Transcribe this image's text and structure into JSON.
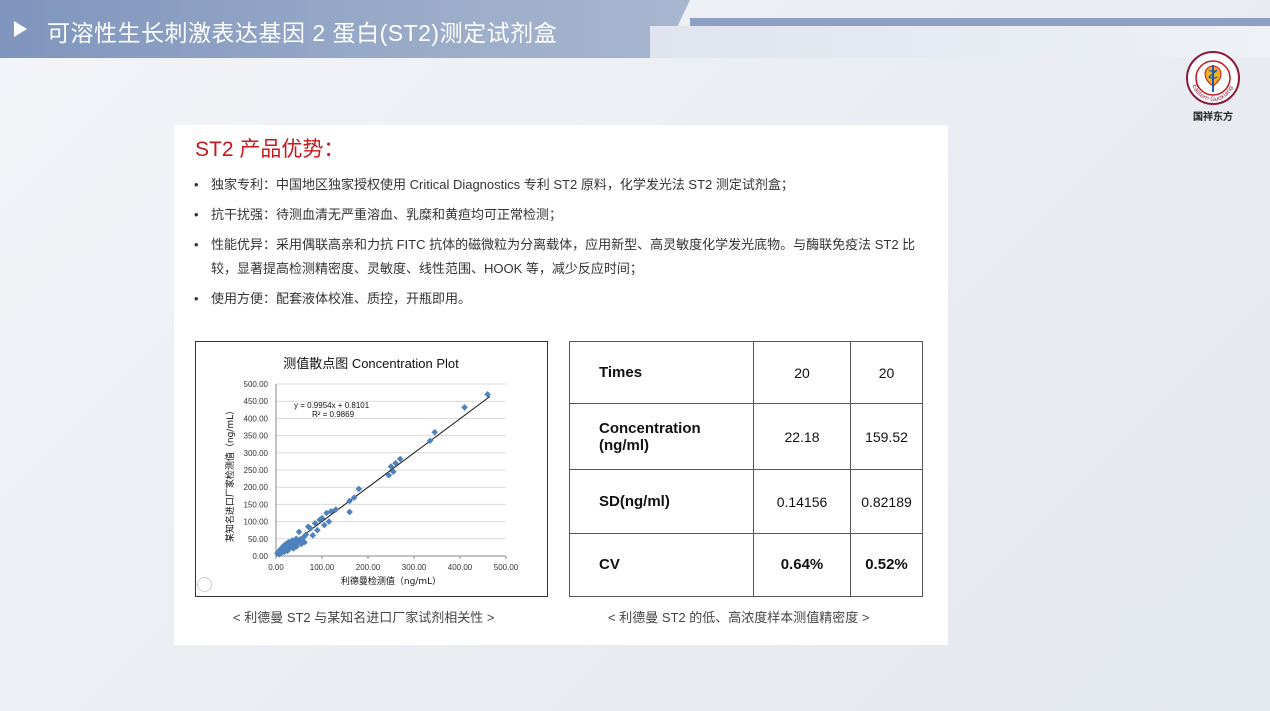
{
  "header": {
    "title": "可溶性生长刺激表达基因 2 蛋白(ST2)测定试剂盒"
  },
  "logo": {
    "ring_text": "Eastern Guoxiang",
    "name": "国祥东方"
  },
  "section": {
    "title": "ST2 产品优势：",
    "bullet_symbol": "•",
    "bullets": [
      "独家专利：中国地区独家授权使用 Critical Diagnostics 专利 ST2 原料，化学发光法 ST2 测定试剂盒；",
      "抗干扰强：待测血清无严重溶血、乳糜和黄疸均可正常检测；",
      "性能优异：采用偶联高亲和力抗 FITC 抗体的磁微粒为分离载体，应用新型、高灵敏度化学发光底物。与酶联免疫法 ST2 比较，显著提高检测精密度、灵敏度、线性范围、HOOK 等，减少反应时间；",
      "使用方便：配套液体校准、质控，开瓶即用。"
    ]
  },
  "chart_data": {
    "type": "scatter",
    "title": "测值散点图 Concentration Plot",
    "xlabel": "利德曼检测值（ng/mL）",
    "ylabel": "某知名进口厂家检测值（ng/mL）",
    "xlim": [
      0,
      500
    ],
    "ylim": [
      0,
      500
    ],
    "x_ticks": [
      "0.00",
      "100.00",
      "200.00",
      "300.00",
      "400.00",
      "500.00"
    ],
    "y_ticks": [
      "0.00",
      "50.00",
      "100.00",
      "150.00",
      "200.00",
      "250.00",
      "300.00",
      "350.00",
      "400.00",
      "450.00",
      "500.00"
    ],
    "grid": true,
    "marker_color": "#4f81bd",
    "trendline": {
      "slope": 0.9954,
      "intercept": 0.8101
    },
    "equation": "y = 0.9954x + 0.8101",
    "r_squared": "R² = 0.9869",
    "points": [
      [
        3,
        8
      ],
      [
        5,
        12
      ],
      [
        7,
        5
      ],
      [
        8,
        15
      ],
      [
        10,
        20
      ],
      [
        12,
        10
      ],
      [
        14,
        25
      ],
      [
        15,
        18
      ],
      [
        17,
        30
      ],
      [
        18,
        12
      ],
      [
        20,
        22
      ],
      [
        22,
        35
      ],
      [
        24,
        28
      ],
      [
        25,
        15
      ],
      [
        27,
        40
      ],
      [
        28,
        20
      ],
      [
        30,
        32
      ],
      [
        32,
        25
      ],
      [
        34,
        38
      ],
      [
        35,
        45
      ],
      [
        37,
        30
      ],
      [
        38,
        22
      ],
      [
        40,
        42
      ],
      [
        42,
        35
      ],
      [
        44,
        50
      ],
      [
        45,
        28
      ],
      [
        47,
        40
      ],
      [
        50,
        70
      ],
      [
        52,
        48
      ],
      [
        55,
        35
      ],
      [
        58,
        45
      ],
      [
        60,
        55
      ],
      [
        62,
        40
      ],
      [
        65,
        62
      ],
      [
        70,
        85
      ],
      [
        75,
        80
      ],
      [
        80,
        60
      ],
      [
        85,
        95
      ],
      [
        90,
        75
      ],
      [
        95,
        105
      ],
      [
        100,
        110
      ],
      [
        105,
        90
      ],
      [
        110,
        125
      ],
      [
        115,
        100
      ],
      [
        120,
        130
      ],
      [
        130,
        135
      ],
      [
        160,
        128
      ],
      [
        160,
        160
      ],
      [
        170,
        170
      ],
      [
        180,
        195
      ],
      [
        245,
        235
      ],
      [
        250,
        260
      ],
      [
        255,
        245
      ],
      [
        260,
        270
      ],
      [
        270,
        282
      ],
      [
        335,
        335
      ],
      [
        345,
        360
      ],
      [
        410,
        432
      ],
      [
        460,
        470
      ]
    ]
  },
  "stats_table": {
    "rows": [
      {
        "label": "Times",
        "low": "20",
        "high": "20",
        "emphasis": false
      },
      {
        "label": "Concentration (ng/ml)",
        "low": "22.18",
        "high": "159.52",
        "emphasis": false
      },
      {
        "label": "SD(ng/ml)",
        "low": "0.14156",
        "high": "0.82189",
        "emphasis": false
      },
      {
        "label": "CV",
        "low": "0.64%",
        "high": "0.52%",
        "emphasis": true
      }
    ]
  },
  "captions": {
    "chart": "< 利德曼 ST2 与某知名进口厂家试剂相关性 >",
    "table": "< 利德曼 ST2 的低、高浓度样本测值精密度 >"
  }
}
